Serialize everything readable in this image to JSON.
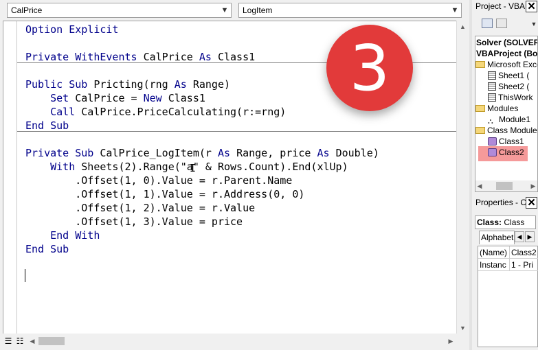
{
  "code_window": {
    "object_combo": "CalPrice",
    "procedure_combo": "LogItem",
    "lines": [
      [
        {
          "t": "Option Explicit",
          "k": 1
        }
      ],
      [],
      [
        {
          "t": "Private WithEvents ",
          "k": 1
        },
        {
          "t": "CalPrice ",
          "k": 0
        },
        {
          "t": "As ",
          "k": 1
        },
        {
          "t": "Class1",
          "k": 0
        }
      ],
      [],
      [
        {
          "t": "Public Sub ",
          "k": 1
        },
        {
          "t": "Pricting(rng ",
          "k": 0
        },
        {
          "t": "As ",
          "k": 1
        },
        {
          "t": "Range)",
          "k": 0
        }
      ],
      [
        {
          "t": "    Set ",
          "k": 1
        },
        {
          "t": "CalPrice = ",
          "k": 0
        },
        {
          "t": "New ",
          "k": 1
        },
        {
          "t": "Class1",
          "k": 0
        }
      ],
      [
        {
          "t": "    Call ",
          "k": 1
        },
        {
          "t": "CalPrice.PriceCalculating(r:=rng)",
          "k": 0
        }
      ],
      [
        {
          "t": "End Sub",
          "k": 1
        }
      ],
      [],
      [
        {
          "t": "Private Sub ",
          "k": 1
        },
        {
          "t": "CalPrice_LogItem(r ",
          "k": 0
        },
        {
          "t": "As ",
          "k": 1
        },
        {
          "t": "Range, price ",
          "k": 0
        },
        {
          "t": "As ",
          "k": 1
        },
        {
          "t": "Double)",
          "k": 0
        }
      ],
      [
        {
          "t": "    With ",
          "k": 1
        },
        {
          "t": "Sheets(2).Range(\"a\" & Rows.Count).End(xlUp)",
          "k": 0
        }
      ],
      [
        {
          "t": "        .Offset(1, 0).Value = r.Parent.Name",
          "k": 0
        }
      ],
      [
        {
          "t": "        .Offset(1, 1).Value = r.Address(0, 0)",
          "k": 0
        }
      ],
      [
        {
          "t": "        .Offset(1, 2).Value = r.Value",
          "k": 0
        }
      ],
      [
        {
          "t": "        .Offset(1, 3).Value = price",
          "k": 0
        }
      ],
      [
        {
          "t": "    End With",
          "k": 1
        }
      ],
      [
        {
          "t": "End Sub",
          "k": 1
        }
      ]
    ],
    "keyword_color": "#00008b",
    "separators_after_lines": [
      2,
      7
    ]
  },
  "badge": {
    "text": "3",
    "color": "#e23a3a"
  },
  "project_pane": {
    "title": "Project - VBAP",
    "close": "✕",
    "tree": [
      {
        "label": "Solver (SOLVER",
        "bold": true,
        "icon": "none"
      },
      {
        "label": "VBAProject (Bo",
        "bold": true,
        "icon": "none"
      },
      {
        "label": "Microsoft Exce",
        "icon": "folder"
      },
      {
        "label": "Sheet1 (",
        "icon": "sheet"
      },
      {
        "label": "Sheet2 (",
        "icon": "sheet"
      },
      {
        "label": "ThisWork",
        "icon": "sheet"
      },
      {
        "label": "Modules",
        "icon": "folder"
      },
      {
        "label": "Module1",
        "icon": "module"
      },
      {
        "label": "Class Modules",
        "icon": "folder"
      },
      {
        "label": "Class1",
        "icon": "class"
      },
      {
        "label": "Class2",
        "icon": "class"
      }
    ]
  },
  "properties_pane": {
    "title": "Properties - C",
    "close": "✕",
    "object_label": "Class:",
    "object_value": "Class",
    "tab_alpha": "Alphabet",
    "rows": [
      {
        "name": "(Name)",
        "value": "Class2"
      },
      {
        "name": "Instanc",
        "value": "1 - Pri"
      }
    ]
  }
}
